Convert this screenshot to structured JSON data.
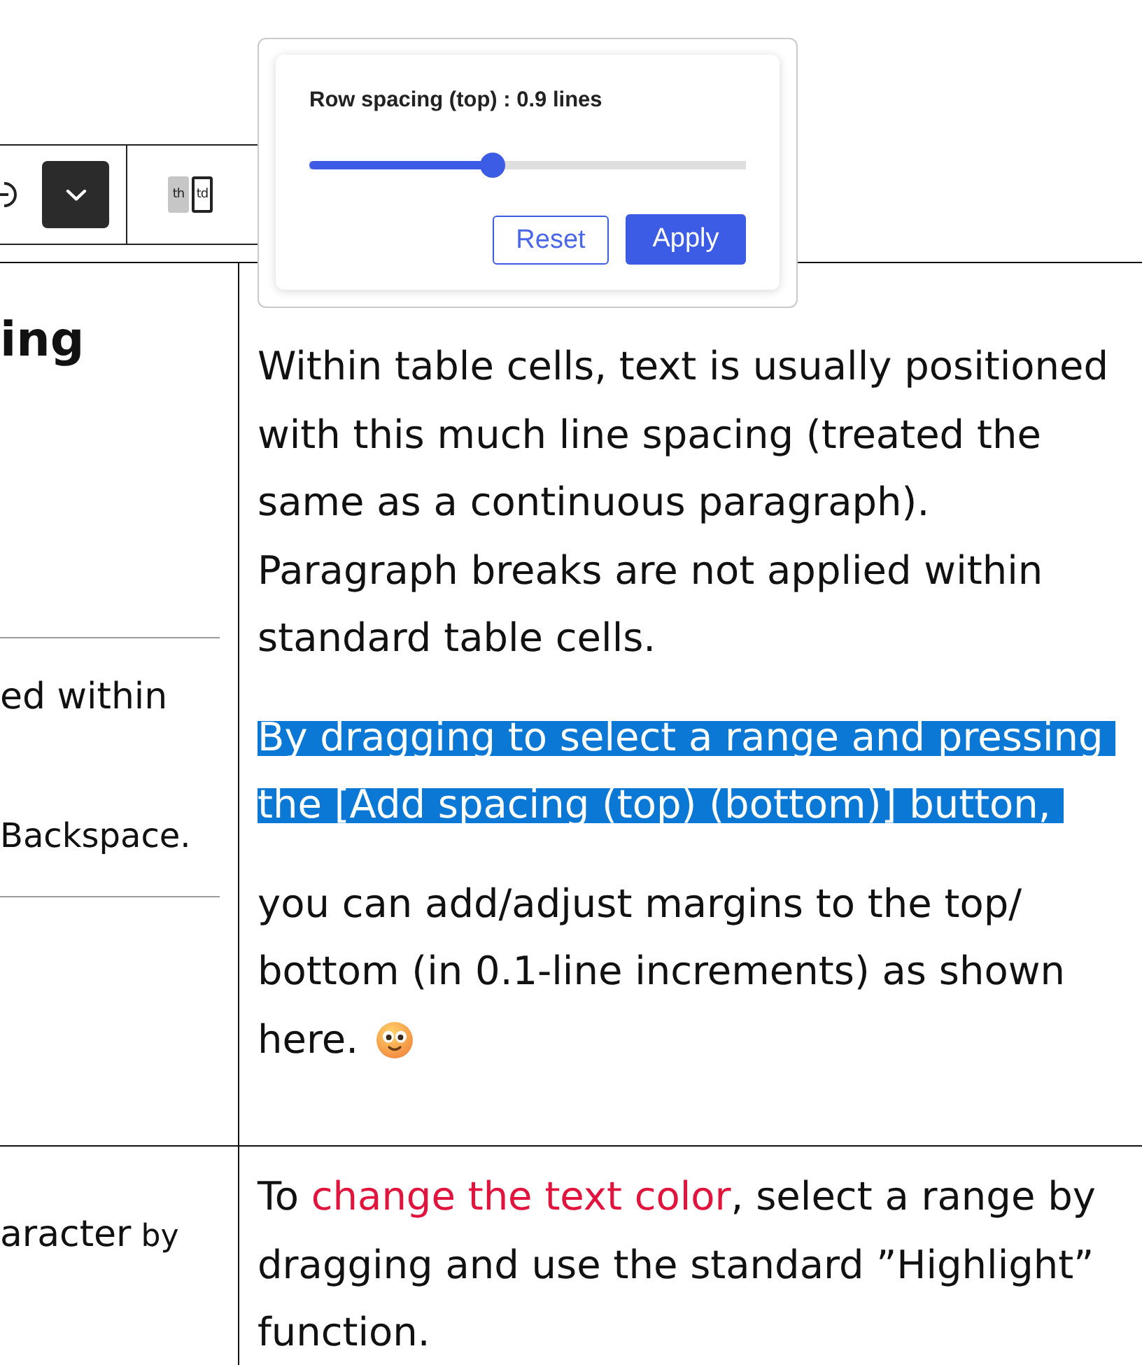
{
  "toolbar": {
    "cell_type_options": [
      {
        "label": "th",
        "selected": false
      },
      {
        "label": "td",
        "selected": true
      }
    ]
  },
  "popup": {
    "label": "Row spacing (top) : 0.9 lines",
    "slider": {
      "level": 0.42
    },
    "buttons": [
      {
        "label": "Reset",
        "kind": "secondary"
      },
      {
        "label": "Apply",
        "kind": "primary"
      }
    ]
  },
  "table": {
    "rows": [
      {
        "side": {
          "sections": [
            {
              "ruled": true,
              "paragraphs": [
                {
                  "kind": "heading",
                  "lines": [
                    "ing"
                  ]
                }
              ]
            },
            {
              "ruled": true,
              "paragraphs": [
                {
                  "kind": "body",
                  "lines": [
                    "ed within"
                  ]
                },
                {
                  "kind": "small",
                  "lines": [
                    "Backspace."
                  ]
                }
              ]
            }
          ]
        },
        "main": {
          "paragraphs": [
            {
              "selected": false,
              "lines": [
                "Within table cells, text is usually positioned",
                "with this much line spacing (treated the",
                "same as a continuous paragraph).",
                "Paragraph breaks are not applied within",
                "standard table cells."
              ]
            },
            {
              "selected": true,
              "lines": [
                "By dragging to select a range and pressing ",
                "the [Add spacing (top) (bottom)] button, "
              ]
            },
            {
              "selected": false,
              "emoji_after": true,
              "lines": [
                "you can add/adjust margins to the top/",
                "bottom (in 0.1-line increments) as shown",
                "here."
              ]
            }
          ]
        }
      },
      {
        "side": {
          "sections": [
            {
              "ruled": false,
              "paragraphs": [
                {
                  "kind": "body",
                  "lines": [
                    {
                      "segments": [
                        {
                          "text": "aracter",
                          "kind": "normal"
                        },
                        {
                          "text": " by",
                          "kind": "small"
                        }
                      ]
                    }
                  ]
                }
              ]
            }
          ]
        },
        "main": {
          "paragraphs": [
            {
              "selected": false,
              "lines": [
                {
                  "segments": [
                    {
                      "text": "To "
                    },
                    {
                      "text": "change the text color",
                      "color": "#e0143c"
                    },
                    {
                      "text": ", select a range by"
                    }
                  ]
                },
                "dragging and use the standard ”Highlight”",
                "function."
              ]
            }
          ]
        }
      }
    ]
  }
}
